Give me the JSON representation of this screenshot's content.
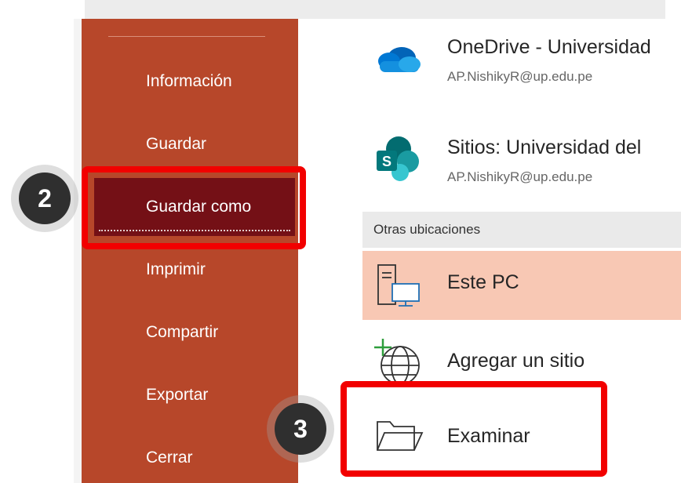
{
  "sidebar": {
    "items": [
      {
        "label": "Información"
      },
      {
        "label": "Guardar"
      },
      {
        "label": "Guardar como"
      },
      {
        "label": "Imprimir"
      },
      {
        "label": "Compartir"
      },
      {
        "label": "Exportar"
      },
      {
        "label": "Cerrar"
      }
    ],
    "active_index": 2,
    "color": "#b7472a",
    "active_color": "#741016"
  },
  "locations": [
    {
      "title": "OneDrive - Universidad",
      "account": "AP.NishikyR@up.edu.pe",
      "icon": "onedrive-icon"
    },
    {
      "title": "Sitios: Universidad del",
      "account": "AP.NishikyR@up.edu.pe",
      "icon": "sharepoint-icon"
    }
  ],
  "other_locations": {
    "header": "Otras ubicaciones",
    "items": [
      {
        "label": "Este PC",
        "icon": "computer-icon",
        "selected": true
      },
      {
        "label": "Agregar un sitio",
        "icon": "globe-plus-icon"
      },
      {
        "label": "Examinar",
        "icon": "folder-icon"
      }
    ]
  },
  "annotations": [
    {
      "label": "2"
    },
    {
      "label": "3"
    }
  ],
  "highlight_color": "#f20000"
}
